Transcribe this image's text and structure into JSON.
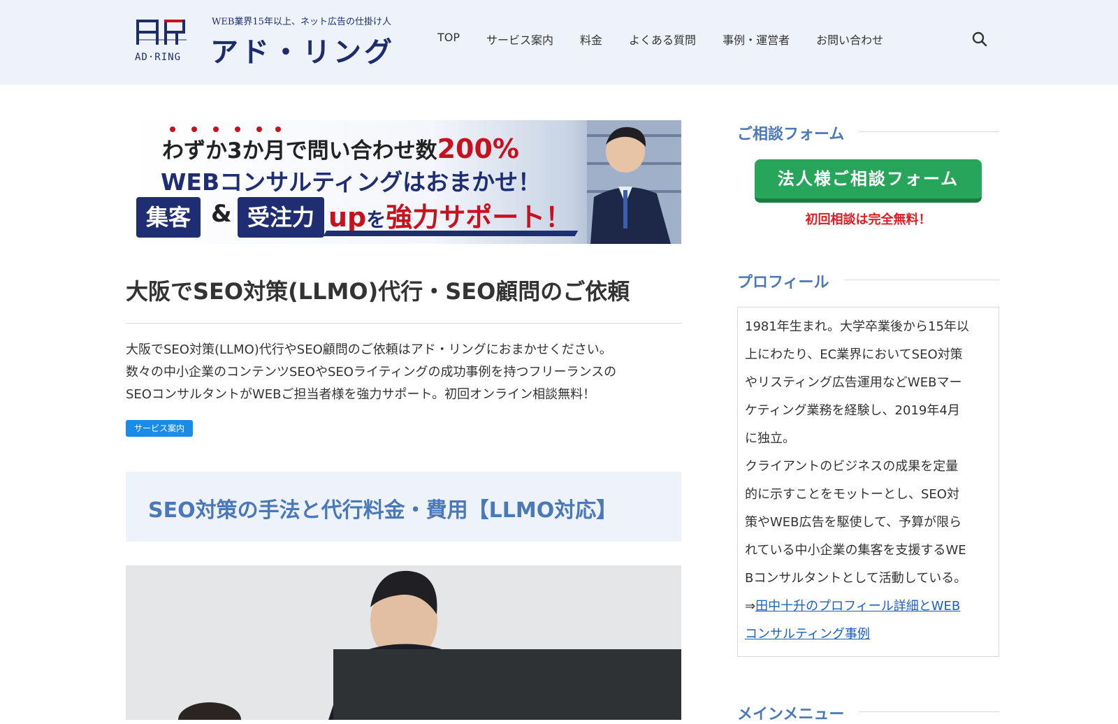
{
  "header": {
    "logo_mark_text": "AD·RING",
    "tagline": "WEB業界15年以上、ネット広告の仕掛け人",
    "site_name": "アド・リング",
    "nav": [
      "TOP",
      "サービス案内",
      "料金",
      "よくある質問",
      "事例・運営者",
      "お問い合わせ"
    ],
    "search_icon": "search-icon"
  },
  "banner": {
    "line1_prefix": "わずか3か月で問い合わせ数",
    "line1_highlight": "200%",
    "line2": "WEBコンサルティングはおまかせ！",
    "tag1": "集客",
    "amp": "&",
    "tag2": "受注力",
    "up": "up",
    "wo": "を",
    "support": "強力サポート！"
  },
  "main": {
    "title": "大阪でSEO対策(LLMO)代行・SEO顧問のご依頼",
    "intro": [
      "大阪でSEO対策(LLMO)代行やSEO顧問のご依頼はアド・リングにおまかせください。",
      "数々の中小企業のコンテンツSEOやSEOライティングの成功事例を持つフリーランスの",
      "SEOコンサルタントがWEBご担当者様を強力サポート。初回オンライン相談無料！"
    ],
    "category_tag": "サービス案内",
    "section_heading": "SEO対策の手法と代行料金・費用【LLMO対応】"
  },
  "sidebar": {
    "consult_heading": "ご相談フォーム",
    "consult_button": "法人様ご相談フォーム",
    "consult_note": "初回相談は完全無料！",
    "profile_heading": "プロフィール",
    "profile_lines": [
      "1981年生まれ。大学卒業後から15年以",
      "上にわたり、EC業界においてSEO対策",
      "やリスティング広告運用などWEBマー",
      "ケティング業務を経験し、2019年4月",
      "に独立。",
      "クライアントのビジネスの成果を定量",
      "的に示すことをモットーとし、SEO対",
      "策やWEB広告を駆使して、予算が限ら",
      "れている中小企業の集客を支援するWE",
      "Bコンサルタントとして活動している。"
    ],
    "profile_link_prefix": "⇒",
    "profile_link_line1": "田中十升のプロフィール詳細とWEB",
    "profile_link_line2": "コンサルティング事例",
    "menu_heading": "メインメニュー"
  },
  "colors": {
    "header_bg": "#eef3fa",
    "brand_navy": "#1d2c6b",
    "accent_blue": "#4a78b8",
    "cta_green": "#27a55a",
    "cta_note_red": "#e11b22",
    "tag_blue": "#1a8ce8"
  }
}
